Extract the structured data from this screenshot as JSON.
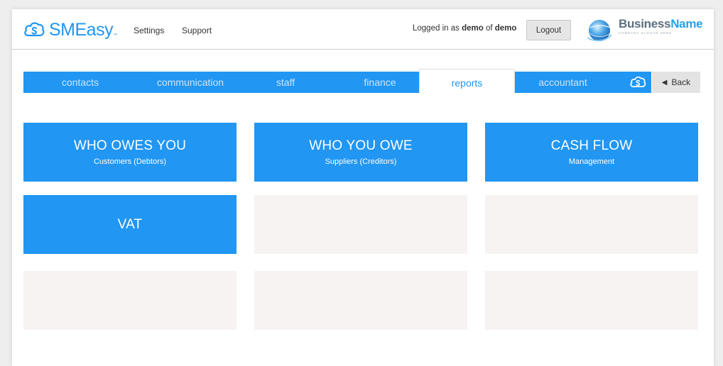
{
  "brand": {
    "name": "SMEasy",
    "tm": "™"
  },
  "nav": {
    "settings": "Settings",
    "support": "Support"
  },
  "login": {
    "prefix": "Logged in as",
    "user": "demo",
    "of": "of",
    "org": "demo",
    "logout_label": "Logout"
  },
  "business_logo": {
    "name_part1": "Business",
    "name_part2": "Name",
    "slogan": "COMPANY SLOGAN HERE"
  },
  "tabs": [
    {
      "label": "contacts"
    },
    {
      "label": "communication"
    },
    {
      "label": "staff"
    },
    {
      "label": "finance"
    },
    {
      "label": "reports",
      "active": true
    },
    {
      "label": "accountant"
    }
  ],
  "back_label": "Back",
  "tiles": [
    {
      "title": "WHO OWES YOU",
      "subtitle": "Customers (Debtors)"
    },
    {
      "title": "WHO YOU OWE",
      "subtitle": "Suppliers (Creditors)"
    },
    {
      "title": "CASH FLOW",
      "subtitle": "Management"
    },
    {
      "title": "VAT",
      "subtitle": ""
    }
  ],
  "colors": {
    "accent": "#2196f3",
    "tab_inactive_text": "#cfe6fb",
    "empty_tile": "#f6f3f2",
    "back_bg": "#e3e3e3"
  },
  "icons": {
    "brand": "cloud-s-logo-icon",
    "tab_end": "cloud-s-icon",
    "back": "triangle-left-icon",
    "business": "globe-logo-icon"
  }
}
